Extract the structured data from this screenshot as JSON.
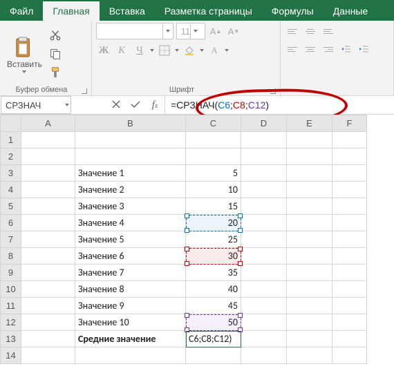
{
  "tabs": {
    "file": "Файл",
    "home": "Главная",
    "insert": "Вставка",
    "layout": "Разметка страницы",
    "formulas": "Формулы",
    "data": "Данные"
  },
  "ribbon": {
    "paste_label": "Вставить",
    "clipboard_label": "Буфер обмена",
    "font_name_placeholder": "",
    "font_size_value": "11",
    "font_label": "Шрифт",
    "bold": "Ж",
    "italic": "К",
    "underline": "Ч"
  },
  "formula_bar": {
    "name_box": "СРЗНАЧ",
    "formula_prefix": "=СРЗНАЧ(",
    "ref1": "C6",
    "ref2": "C8",
    "ref3": "C12",
    "formula_suffix": ")"
  },
  "columns": [
    "A",
    "B",
    "C",
    "D",
    "E",
    "F"
  ],
  "rows": [
    {
      "n": 1,
      "b": "",
      "c": ""
    },
    {
      "n": 2,
      "b": "",
      "c": ""
    },
    {
      "n": 3,
      "b": "Значение 1",
      "c": "5"
    },
    {
      "n": 4,
      "b": "Значение 2",
      "c": "10"
    },
    {
      "n": 5,
      "b": "Значение 3",
      "c": "15"
    },
    {
      "n": 6,
      "b": "Значение 4",
      "c": "20"
    },
    {
      "n": 7,
      "b": "Значение 5",
      "c": "25"
    },
    {
      "n": 8,
      "b": "Значение 6",
      "c": "30"
    },
    {
      "n": 9,
      "b": "Значение 7",
      "c": "35"
    },
    {
      "n": 10,
      "b": "Значение 8",
      "c": "40"
    },
    {
      "n": 11,
      "b": "Значение 9",
      "c": "45"
    },
    {
      "n": 12,
      "b": "Значение 10",
      "c": "50"
    },
    {
      "n": 13,
      "b": "Средние значение",
      "c": "C6;C8;C12)"
    },
    {
      "n": 14,
      "b": "",
      "c": ""
    }
  ]
}
